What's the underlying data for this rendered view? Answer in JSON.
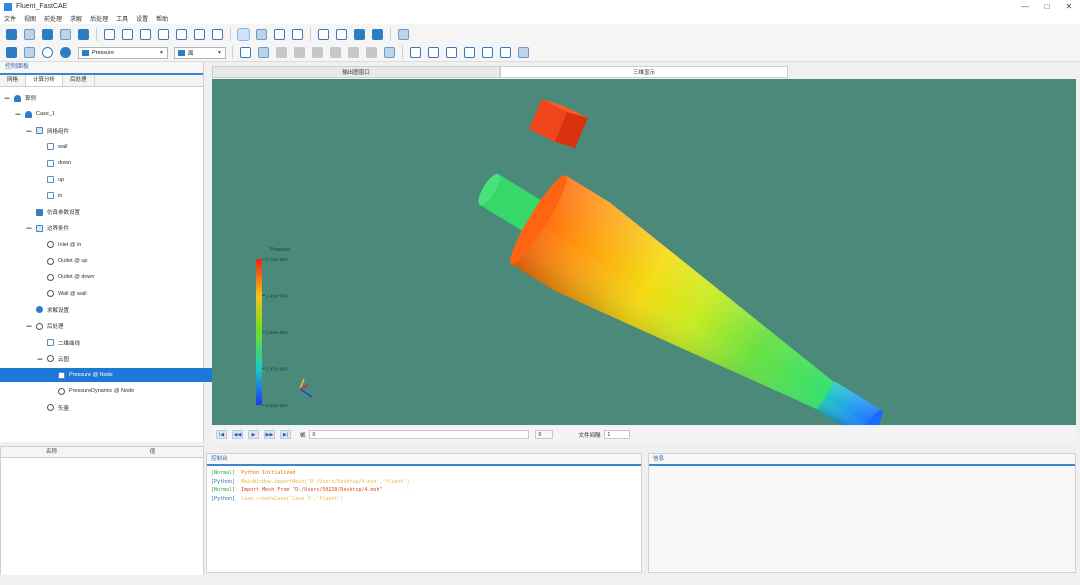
{
  "window": {
    "title": "Fluent_FastCAE",
    "controls": [
      "—",
      "□",
      "✕"
    ]
  },
  "menu": [
    "文件",
    "视图",
    "前处理",
    "求解",
    "后处理",
    "工具",
    "设置",
    "帮助"
  ],
  "toolbar2": {
    "combo1": "Pressure",
    "combo2": "面"
  },
  "left_panel": {
    "header": "控制面板",
    "tabs": [
      "网格",
      "计算分析",
      "后处理"
    ],
    "active_tab": 1,
    "tree": [
      {
        "label": "算例",
        "level": 0,
        "icon": "user",
        "expander": "▬"
      },
      {
        "label": "Case_1",
        "level": 1,
        "icon": "user",
        "expander": "▬"
      },
      {
        "label": "网格组件",
        "level": 2,
        "icon": "folder",
        "expander": "▬"
      },
      {
        "label": "wall",
        "level": 3,
        "icon": "node",
        "expander": ""
      },
      {
        "label": "down",
        "level": 3,
        "icon": "node",
        "expander": ""
      },
      {
        "label": "up",
        "level": 3,
        "icon": "node",
        "expander": ""
      },
      {
        "label": "in",
        "level": 3,
        "icon": "node",
        "expander": ""
      },
      {
        "label": "仿真参数设置",
        "level": 2,
        "icon": "cfg",
        "expander": ""
      },
      {
        "label": "边界条件",
        "level": 2,
        "icon": "folder",
        "expander": "▬"
      },
      {
        "label": "Inlet @ in",
        "level": 3,
        "icon": "circ",
        "expander": ""
      },
      {
        "label": "Outlet @ up",
        "level": 3,
        "icon": "circ",
        "expander": ""
      },
      {
        "label": "Outlet @ down",
        "level": 3,
        "icon": "circ",
        "expander": ""
      },
      {
        "label": "Wall @ wall",
        "level": 3,
        "icon": "circ",
        "expander": ""
      },
      {
        "label": "求解设置",
        "level": 2,
        "icon": "circblue",
        "expander": ""
      },
      {
        "label": "后处理",
        "level": 2,
        "icon": "circ",
        "expander": "▬"
      },
      {
        "label": "二维曲线",
        "level": 3,
        "icon": "node",
        "expander": ""
      },
      {
        "label": "云图",
        "level": 3,
        "icon": "circ",
        "expander": "▬"
      },
      {
        "label": "Pressure @ Node",
        "level": 4,
        "icon": "node",
        "expander": "",
        "selected": true
      },
      {
        "label": "PressureDynamic @ Node",
        "level": 4,
        "icon": "circ",
        "expander": ""
      },
      {
        "label": "矢量",
        "level": 3,
        "icon": "circ",
        "expander": ""
      }
    ]
  },
  "property_panel": {
    "col_name": "名称",
    "col_value": "值"
  },
  "view_tabs": [
    "输出图窗口",
    "三维显示"
  ],
  "active_view_tab": 1,
  "legend": {
    "title": "Pressure",
    "labels": [
      "3.73e+004",
      "1.45e+004",
      "1.04e+004",
      "2.37e+003",
      "5.84e+004"
    ]
  },
  "animation": {
    "buttons": [
      "|◀",
      "◀◀",
      "▶",
      "▶▶",
      "▶|"
    ],
    "frame_label": "帧",
    "frame_value": "0",
    "frame_total": "0",
    "speed_label": "文件间隔",
    "speed_value": "1"
  },
  "console": {
    "title": "控制台",
    "lines": [
      {
        "tag": "[Normal]",
        "text": "Python Initialized",
        "tag_color": "#2ba34a",
        "color": "#e07a10"
      },
      {
        "tag": "[Python]",
        "text": "MainWindow.importMesh('D:/Users/Desktop/4.msh','fluent')",
        "tag_color": "#2e6bb0",
        "color": "#e8b84a"
      },
      {
        "tag": "[Normal]",
        "text": "Import Mesh From \"D:/Users/50220/Desktop/4.msh\"",
        "tag_color": "#2ba34a",
        "color": "#d04a2a"
      },
      {
        "tag": "[Python]",
        "text": "Case.createCase('Case_1','fluent')",
        "tag_color": "#2e6bb0",
        "color": "#e8b84a"
      }
    ]
  },
  "output_panel": {
    "title": "信息"
  }
}
